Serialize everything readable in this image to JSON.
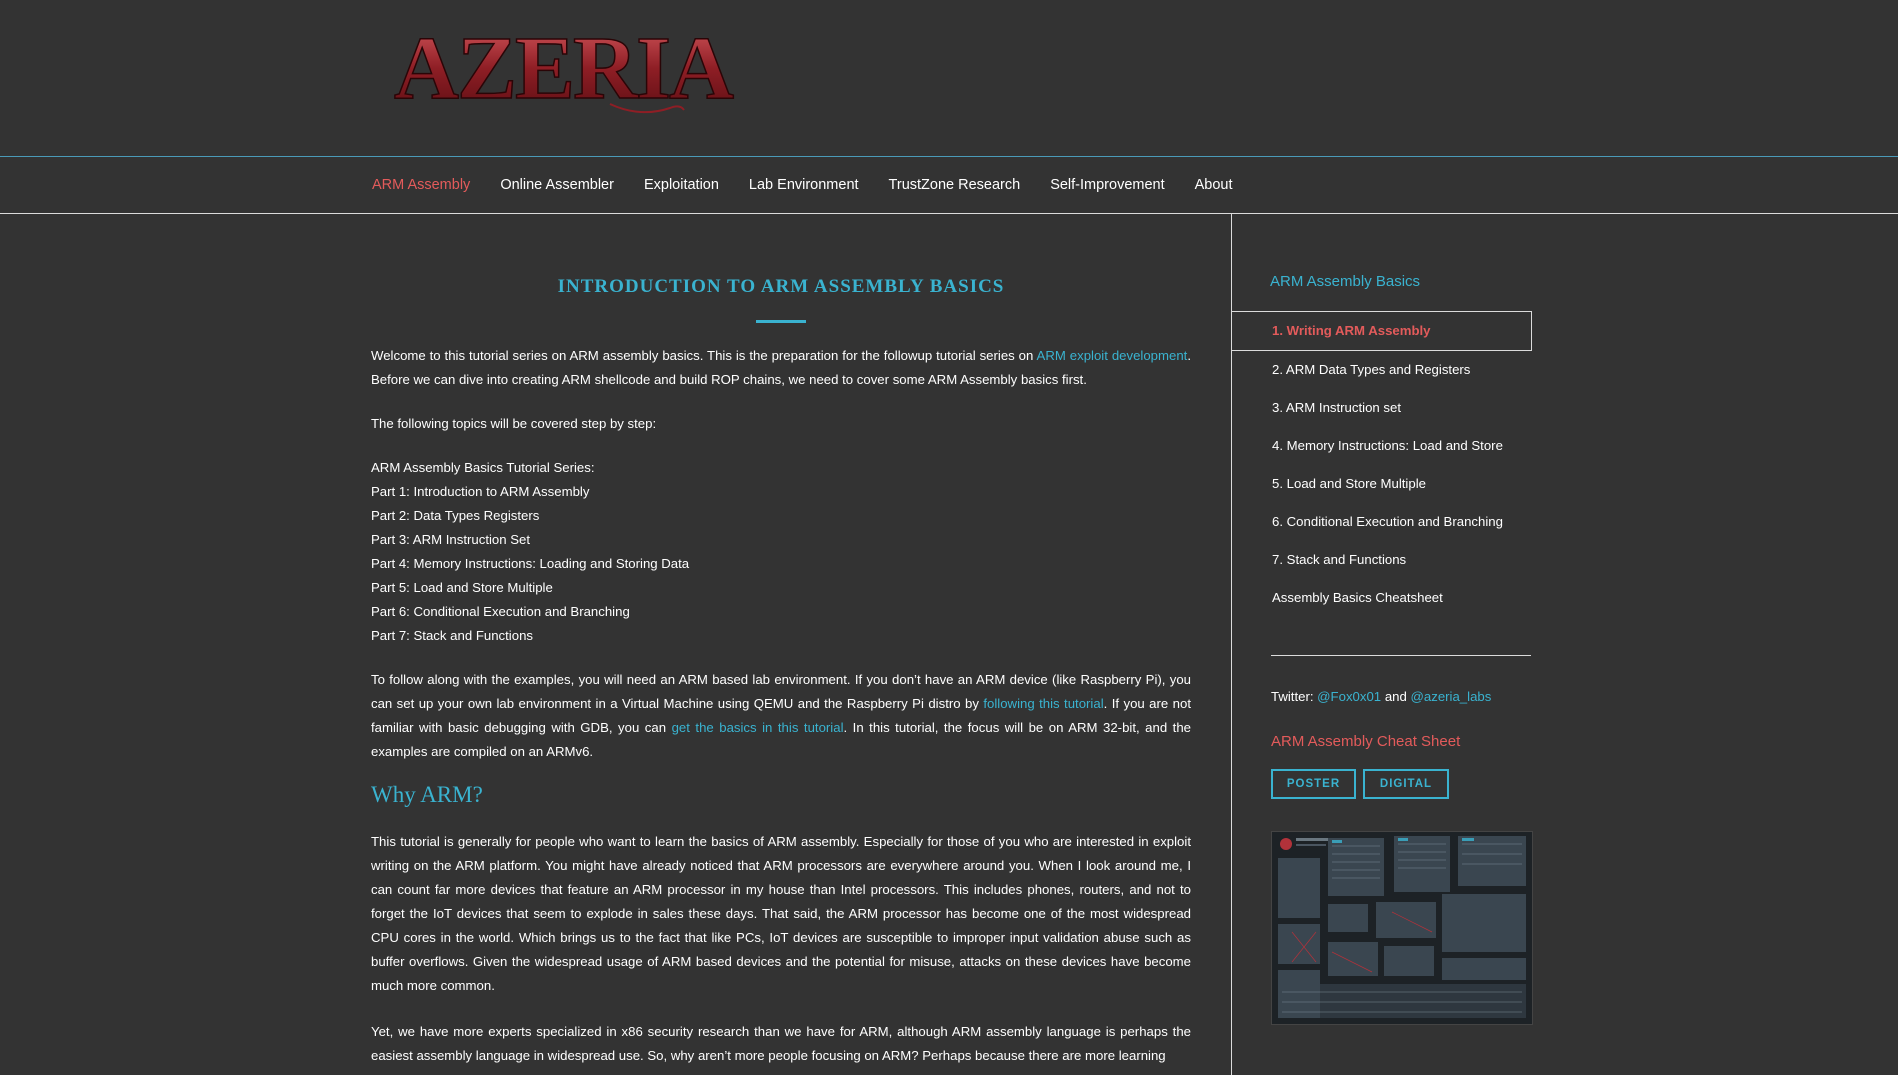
{
  "logo": {
    "text": "AZERIA"
  },
  "nav": {
    "items": [
      {
        "label": "ARM Assembly",
        "active": true
      },
      {
        "label": "Online Assembler"
      },
      {
        "label": "Exploitation"
      },
      {
        "label": "Lab Environment"
      },
      {
        "label": "TrustZone Research"
      },
      {
        "label": "Self-Improvement"
      },
      {
        "label": "About"
      }
    ]
  },
  "article": {
    "title": "INTRODUCTION TO ARM ASSEMBLY BASICS",
    "intro": {
      "before_link": "Welcome to this tutorial series on ARM assembly basics. This is the preparation for the followup tutorial series on ",
      "link": "ARM exploit development",
      "after_link": ". Before we can dive into creating ARM shellcode and build ROP chains, we need to cover some ARM Assembly basics first."
    },
    "topics_intro": "The following topics will be covered step by step:",
    "series": [
      "ARM Assembly Basics Tutorial Series:",
      "Part 1: Introduction to ARM Assembly",
      "Part 2: Data Types Registers",
      "Part 3: ARM Instruction Set",
      "Part 4: Memory Instructions: Loading and Storing Data",
      "Part 5: Load and Store Multiple",
      "Part 6: Conditional Execution and Branching",
      "Part 7: Stack and Functions"
    ],
    "lab_paragraph": {
      "part1": "To follow along with the examples, you will need an ARM based lab environment. If you don’t have an ARM device (like Raspberry Pi), you can set up your own lab environment in a Virtual Machine using QEMU and the Raspberry Pi distro by ",
      "link1": "following this tutorial",
      "part2": ". If you are not familiar with basic debugging with GDB, you can ",
      "link2": "get the basics in this tutorial",
      "part3": ". In this tutorial, the focus will be on ARM 32-bit, and the examples are compiled on an ARMv6."
    },
    "why_heading": "Why ARM?",
    "why_paragraph": "This tutorial is generally for people who want to learn the basics of ARM assembly. Especially for those of you who are interested in exploit writing on the ARM platform. You might have already noticed that ARM processors are everywhere around you. When I look around me, I can count far more devices that feature an ARM processor in my house than Intel processors. This includes phones, routers, and not to forget the IoT devices that seem to explode in sales these days. That said, the ARM processor has become one of the most widespread CPU cores in the world. Which brings us to the fact that like PCs, IoT devices are susceptible to improper input validation abuse such as buffer overflows. Given the widespread usage of ARM based devices and the potential for misuse, attacks on these devices have become much more common.",
    "last_paragraph": "Yet, we have more experts specialized in x86 security research than we have for ARM, although ARM assembly language is perhaps the easiest assembly language in widespread use. So, why aren’t more people focusing on ARM? Perhaps because there are more learning"
  },
  "sidebar": {
    "title": "ARM Assembly Basics",
    "items": [
      {
        "label": "1. Writing ARM Assembly",
        "active": true
      },
      {
        "label": "2. ARM Data Types and Registers"
      },
      {
        "label": "3. ARM Instruction set"
      },
      {
        "label": "4. Memory Instructions: Load and Store"
      },
      {
        "label": "5. Load and Store Multiple"
      },
      {
        "label": "6. Conditional Execution and Branching"
      },
      {
        "label": "7. Stack and Functions"
      },
      {
        "label": "Assembly Basics Cheatsheet"
      }
    ],
    "twitter_label": "Twitter:",
    "twitter_handle1": "@Fox0x01",
    "twitter_and": "and",
    "twitter_handle2": "@azeria_labs",
    "cheat_title": "ARM Assembly Cheat Sheet",
    "poster_button": "POSTER",
    "digital_button": "DIGITAL"
  },
  "colors": {
    "background": "#333333",
    "accent_blue": "#3ab3d0",
    "accent_red": "#e35b5b",
    "text": "#ffffff"
  }
}
